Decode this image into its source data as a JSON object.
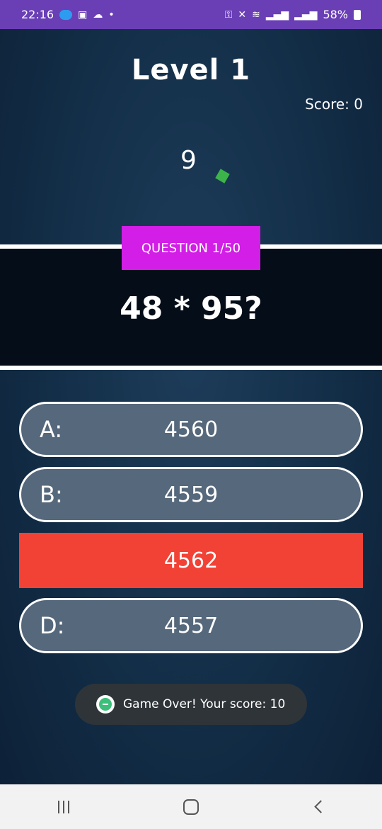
{
  "status_bar": {
    "time": "22:16",
    "battery": "58%",
    "icons": [
      "vpn-key-icon",
      "gallery-icon",
      "cloud-icon",
      "dot-icon",
      "key-icon",
      "mute-icon",
      "wifi-icon",
      "signal-icon",
      "signal-icon",
      "battery-icon"
    ]
  },
  "game": {
    "level": "Level 1",
    "score": "Score: 0",
    "timer": "9"
  },
  "question": {
    "label": "QUESTION 1/50",
    "text": "48 * 95?"
  },
  "answers": [
    {
      "letter": "A:",
      "value": "4560",
      "state": "default"
    },
    {
      "letter": "B:",
      "value": "4559",
      "state": "default"
    },
    {
      "letter": "",
      "value": "4562",
      "state": "wrong"
    },
    {
      "letter": "D:",
      "value": "4557",
      "state": "default"
    }
  ],
  "toast": {
    "text": "Game Over! Your score: 10"
  },
  "colors": {
    "status_bar": "#6a3fb5",
    "question_label": "#d21ee6",
    "answer_default": "#56687b",
    "answer_wrong": "#f24236",
    "shape": "#3cb44a"
  }
}
